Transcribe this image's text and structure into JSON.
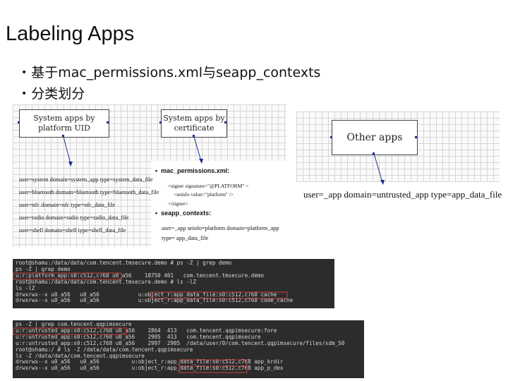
{
  "title": "Labeling Apps",
  "bullets": [
    "基于mac_permissions.xml与seapp_contexts",
    "分类划分"
  ],
  "diagram": {
    "box_system_uid": [
      "System apps by",
      "platform UID"
    ],
    "box_system_cert": [
      "System apps by",
      "certificate"
    ],
    "box_other": "Other apps",
    "uid_rules": [
      "user=system domain=system_app type=system_data_file",
      "user=bluetooth domain=bluetooth type=bluetooth_data_file",
      "user=nfc domain=nfc type=nfc_data_file",
      "user=radio domain=radio type=radio_data_file",
      "user=shell domain=shell type=shell_data_file"
    ],
    "mac_perm_label": "mac_permissions.xml:",
    "mac_perm_lines": [
      "<signer signature=\"@PLATFORM\" >",
      "<seinfo value=\"platform\" />",
      "</signer>"
    ],
    "seapp_label": "seapp_contexts:",
    "seapp_lines": [
      "user=_app seinfo=platform domain=platform_app",
      "type= app_data_file"
    ],
    "other_rule": "user=_app domain=untrusted_app type=app_data_file"
  },
  "terminal1": [
    "root@shamu:/data/data/com.tencent.tmsecure.demo # ps -Z | grep demo",
    "ps -Z | grep demo",
    "u:r:platform_app:s0:c512,c768 u0_a56    18750 401   com.tencent.tmsecure.demo",
    "root@shamu:/data/data/com.tencent.tmsecure.demo # ls -lZ",
    "ls -lZ",
    "drwxrwx--x u0_a56   u0_a56            u:object_r:app_data_file:s0:c512,c768 cache",
    "drwxrwx--x u0_a56   u0_a56            u:object_r:app_data_file:s0:c512,c768 code_cache"
  ],
  "terminal2": [
    "ps -Z | grep com.tencent.qqpimsecure",
    "u:r:untrusted_app:s0:c512,c768 u0_a56    2864  413   com.tencent.qqpimsecure:fore",
    "u:r:untrusted_app:s0:c512,c768 u0_a56    2905  413   com.tencent.qqpimsecure",
    "u:r:untrusted_app:s0:c512,c768 u0_a56    2997  2905  /data/user/0/com.tencent.qqpimsecure/files/xdm_S0",
    "root@shamu:/ # ls -Z /data/data/com.tencent.qqpimsecure",
    "ls -Z /data/data/com.tencent.qqpimsecure",
    "drwxrwx--x u0_a56   u0_a56          u:object_r:app_data_file:s0:c512,c768 app_krdir",
    "drwxrwx--x u0_a56   u0_a56          u:object_r:app_data_file:s0:c512,c768 app_p_dex"
  ]
}
